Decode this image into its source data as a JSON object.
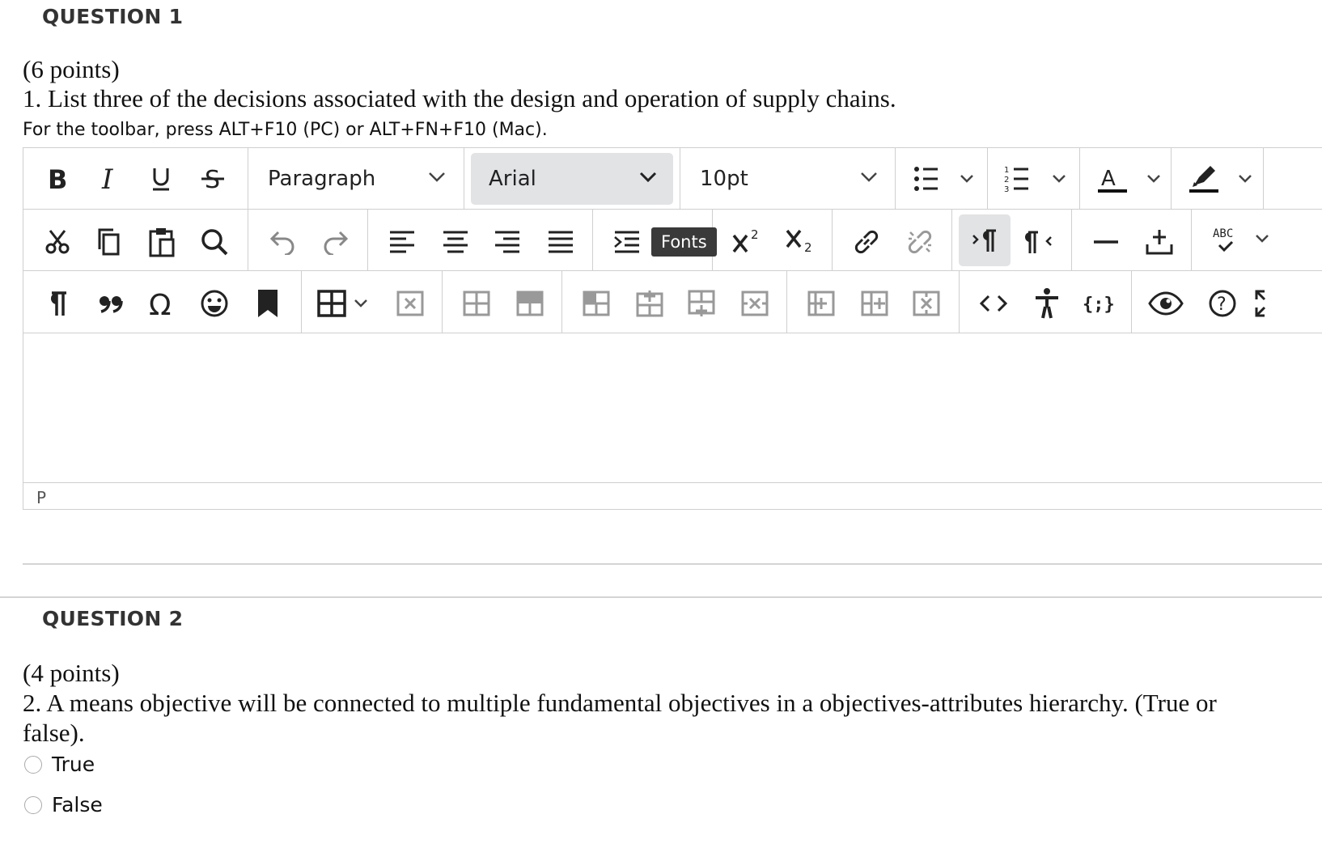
{
  "question1": {
    "heading": "QUESTION 1",
    "points": "(6 points)",
    "text": "1. List three of the decisions associated with the design and operation of supply chains.",
    "hint": "For the toolbar, press ALT+F10 (PC) or ALT+FN+F10 (Mac).",
    "editor": {
      "block_format": "Paragraph",
      "font_family": "Arial",
      "font_size": "10pt",
      "tooltip": "Fonts",
      "status_path": "P",
      "icons_row1": [
        "bold-icon",
        "italic-icon",
        "underline-icon",
        "strikethrough-icon",
        "bullet-list-icon",
        "numbered-list-icon",
        "text-color-icon",
        "highlight-icon"
      ],
      "icons_row2": [
        "cut-icon",
        "copy-icon",
        "paste-icon",
        "find-icon",
        "undo-icon",
        "redo-icon",
        "align-left-icon",
        "align-center-icon",
        "align-right-icon",
        "justify-icon",
        "indent-icon",
        "superscript-icon",
        "subscript-icon",
        "link-icon",
        "unlink-icon",
        "ltr-icon",
        "rtl-icon",
        "horizontal-rule-icon",
        "insert-icon",
        "spellcheck-icon"
      ],
      "icons_row3": [
        "paragraph-mark-icon",
        "blockquote-icon",
        "special-char-icon",
        "emoji-icon",
        "bookmark-icon",
        "table-icon",
        "delete-table-icon",
        "row-props-icon",
        "cell-props-icon",
        "merge-cells-icon",
        "insert-row-before-icon",
        "insert-row-after-icon",
        "delete-row-icon",
        "insert-col-before-icon",
        "insert-col-after-icon",
        "delete-col-icon",
        "source-code-icon",
        "accessibility-icon",
        "code-braces-icon",
        "preview-icon",
        "help-icon",
        "fullscreen-icon"
      ]
    }
  },
  "question2": {
    "heading": "QUESTION 2",
    "points": "(4 points)",
    "text_line1": "2. A means objective will be connected to multiple fundamental objectives in a objectives-attributes hierarchy. (True or",
    "text_line2": "false).",
    "options": [
      "True",
      "False"
    ]
  }
}
